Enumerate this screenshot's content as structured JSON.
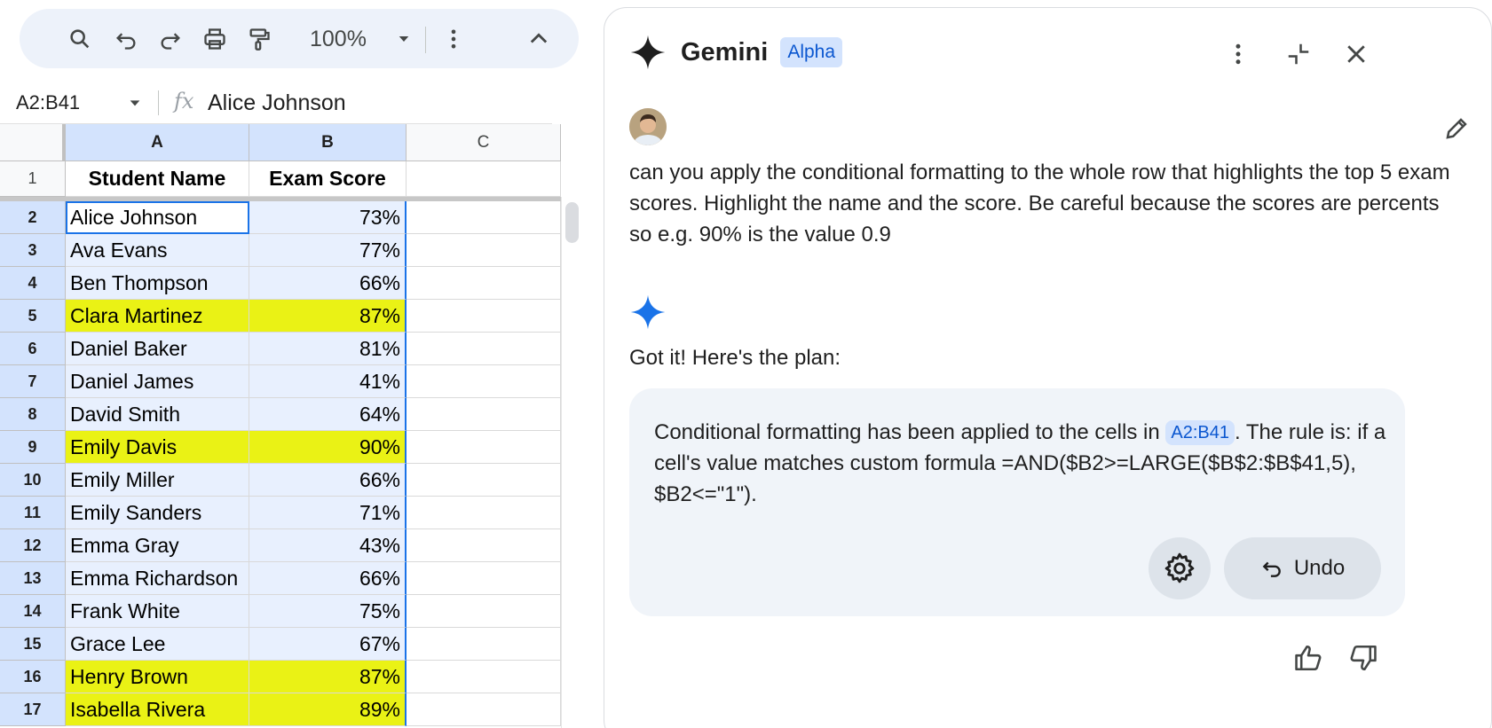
{
  "toolbar": {
    "zoom": "100%",
    "icons": [
      "search-icon",
      "undo-icon",
      "redo-icon",
      "print-icon",
      "paint-format-icon",
      "chevron-down-icon",
      "more-vert-icon",
      "chevron-up-icon"
    ]
  },
  "formula_bar": {
    "name_box": "A2:B41",
    "fx": "fx",
    "value": "Alice Johnson"
  },
  "sheet": {
    "columns": [
      "A",
      "B",
      "C"
    ],
    "header_row": {
      "num": "1",
      "a": "Student Name",
      "b": "Exam Score"
    },
    "rows": [
      {
        "num": "2",
        "name": "Alice Johnson",
        "score": "73%",
        "highlight": false
      },
      {
        "num": "3",
        "name": "Ava Evans",
        "score": "77%",
        "highlight": false
      },
      {
        "num": "4",
        "name": "Ben Thompson",
        "score": "66%",
        "highlight": false
      },
      {
        "num": "5",
        "name": "Clara Martinez",
        "score": "87%",
        "highlight": true
      },
      {
        "num": "6",
        "name": "Daniel Baker",
        "score": "81%",
        "highlight": false
      },
      {
        "num": "7",
        "name": "Daniel James",
        "score": "41%",
        "highlight": false
      },
      {
        "num": "8",
        "name": "David Smith",
        "score": "64%",
        "highlight": false
      },
      {
        "num": "9",
        "name": "Emily Davis",
        "score": "90%",
        "highlight": true
      },
      {
        "num": "10",
        "name": "Emily Miller",
        "score": "66%",
        "highlight": false
      },
      {
        "num": "11",
        "name": "Emily Sanders",
        "score": "71%",
        "highlight": false
      },
      {
        "num": "12",
        "name": "Emma Gray",
        "score": "43%",
        "highlight": false
      },
      {
        "num": "13",
        "name": "Emma Richardson",
        "score": "66%",
        "highlight": false
      },
      {
        "num": "14",
        "name": "Frank White",
        "score": "75%",
        "highlight": false
      },
      {
        "num": "15",
        "name": "Grace Lee",
        "score": "67%",
        "highlight": false
      },
      {
        "num": "16",
        "name": "Henry Brown",
        "score": "87%",
        "highlight": true
      },
      {
        "num": "17",
        "name": "Isabella Rivera",
        "score": "89%",
        "highlight": true
      }
    ]
  },
  "gemini": {
    "title": "Gemini",
    "badge": "Alpha",
    "user_message": "can you apply the conditional formatting to the whole row that highlights the top 5 exam scores. Highlight the name and the score. Be careful because the scores are percents so e.g. 90% is the value 0.9",
    "reply_intro": "Got it! Here's the plan:",
    "result": {
      "text_before": "Conditional formatting has been applied to the cells in ",
      "range": "A2:B41",
      "text_after": ". The rule is: if a cell's value matches custom formula =AND($B2>=LARGE($B$2:$B$41,5), $B2<=\"1\")."
    },
    "undo_label": "Undo"
  },
  "colors": {
    "highlight": "#eaf215",
    "selection": "#e8f0fe",
    "accent": "#1a73e8",
    "gemini_spark": "#1a73e8"
  }
}
